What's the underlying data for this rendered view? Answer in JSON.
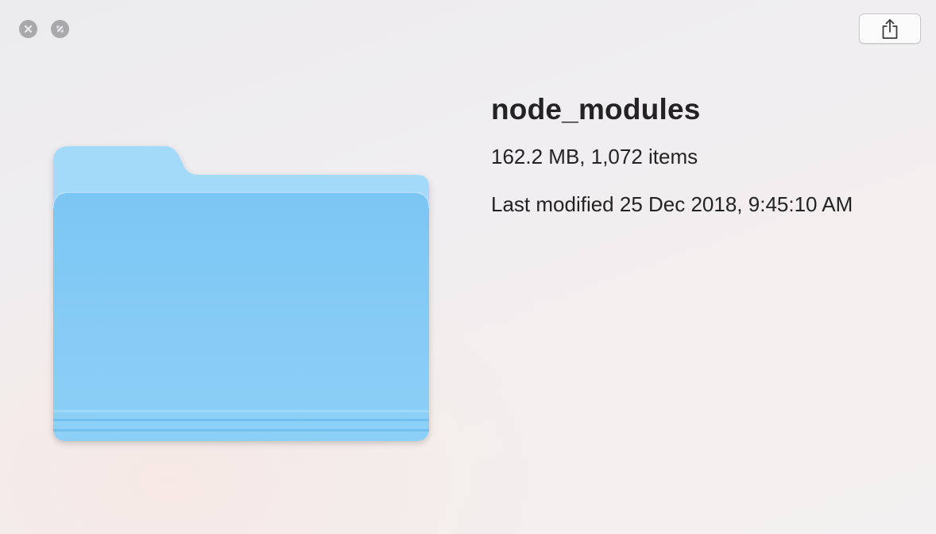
{
  "window": {
    "controls": {
      "close_icon": "close-icon",
      "fullscreen_icon": "fullscreen-icon"
    },
    "share_icon": "share-icon"
  },
  "preview": {
    "icon": "folder-icon",
    "folder_color": "#86c9f4"
  },
  "file": {
    "name": "node_modules",
    "size_summary": "162.2 MB, 1,072 items",
    "modified": "Last modified 25 Dec 2018, 9:45:10 AM"
  }
}
